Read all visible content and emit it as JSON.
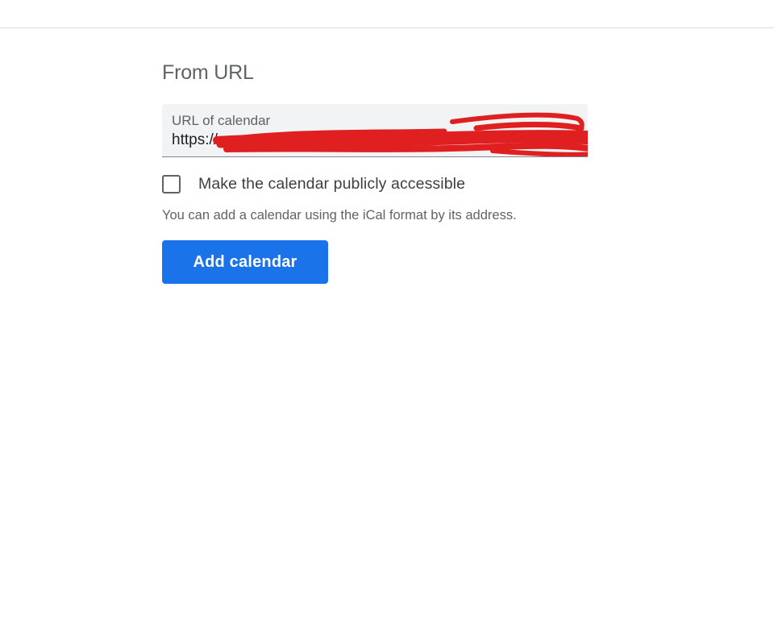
{
  "section": {
    "title": "From URL"
  },
  "url_field": {
    "label": "URL of calendar",
    "value": "https://"
  },
  "public_checkbox": {
    "label": "Make the calendar publicly accessible",
    "checked": false
  },
  "help_text": "You can add a calendar using the iCal format by its address.",
  "add_button": {
    "label": "Add calendar",
    "color": "#1a73e8"
  },
  "redaction_color": "#e02020"
}
